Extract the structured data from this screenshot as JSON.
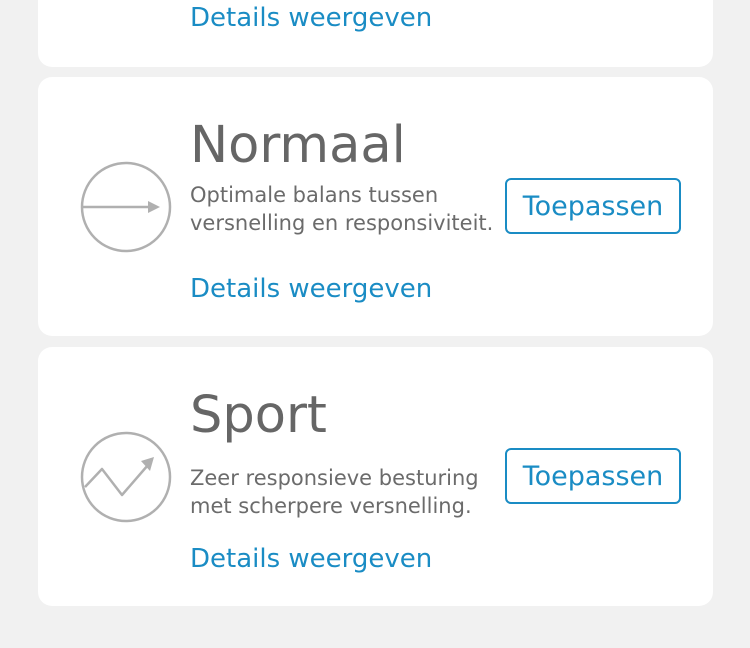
{
  "top_card": {
    "details_label": "Details weergeven"
  },
  "modes": [
    {
      "title": "Normaal",
      "description": "Optimale balans tussen versnelling en responsiviteit.",
      "details_label": "Details weergeven",
      "apply_label": "Toepassen",
      "icon": "arrow-right-circle-icon"
    },
    {
      "title": "Sport",
      "description": "Zeer responsieve besturing met scherpere versnelling.",
      "details_label": "Details weergeven",
      "apply_label": "Toepassen",
      "icon": "zigzag-up-circle-icon"
    }
  ],
  "colors": {
    "accent": "#1a8cc4",
    "icon_stroke": "#b0b0b0",
    "background": "#f1f1f1",
    "card": "#ffffff"
  }
}
